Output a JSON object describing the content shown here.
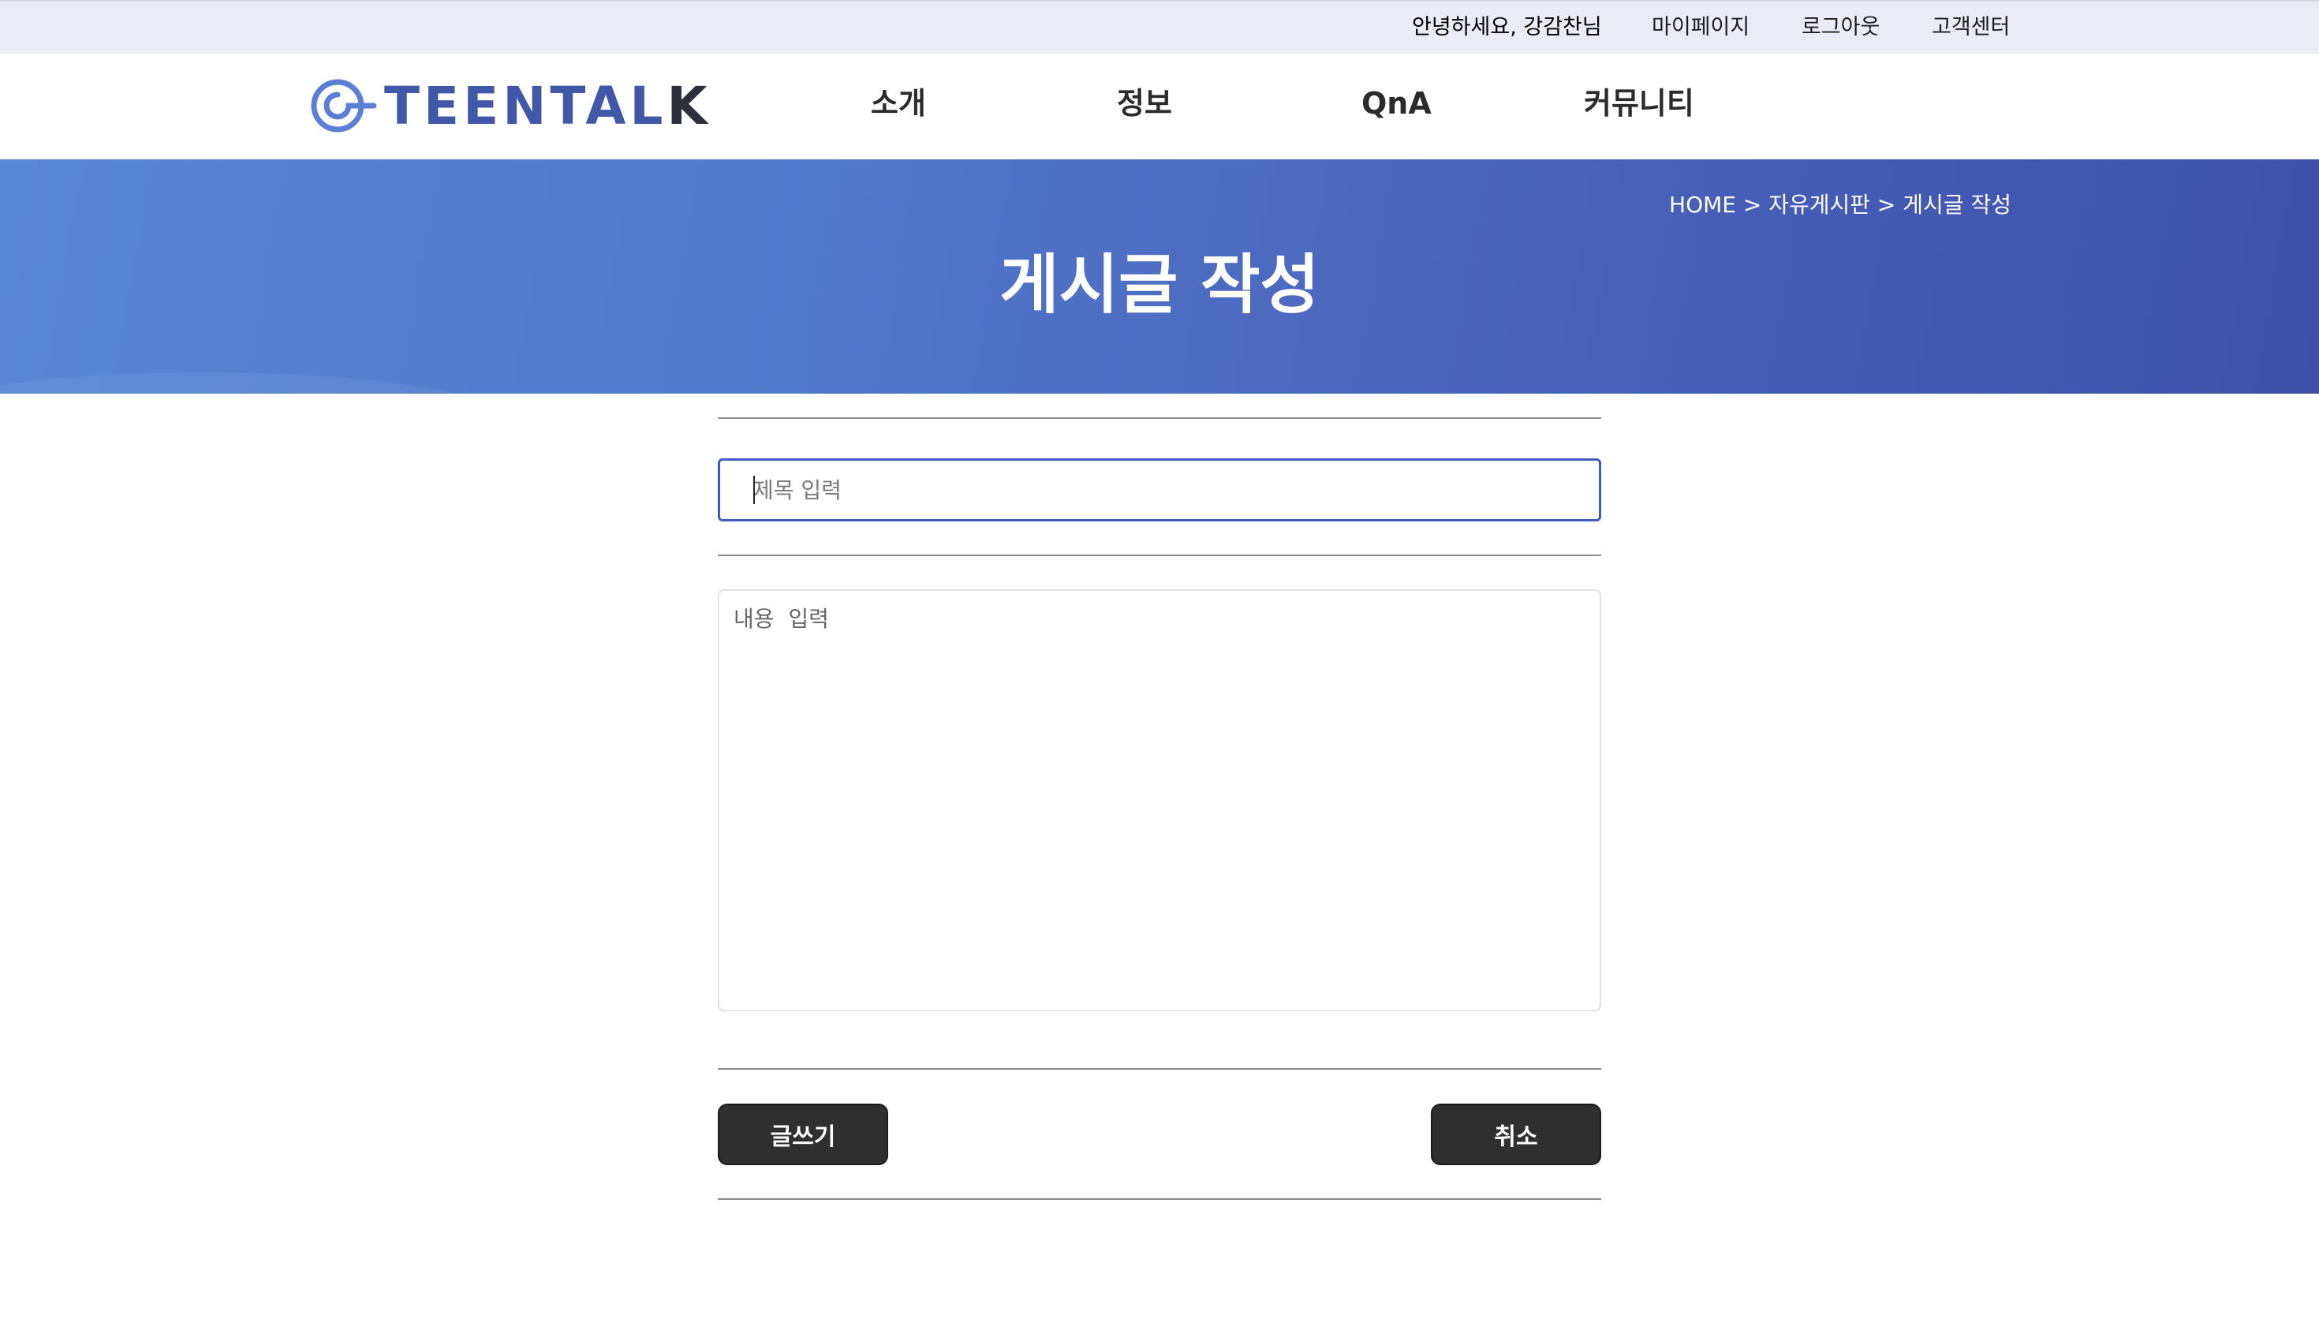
{
  "topbar": {
    "greeting": "안녕하세요, 강감찬님",
    "mypage": "마이페이지",
    "logout": "로그아웃",
    "customer_center": "고객센터"
  },
  "header": {
    "logo_main": "TEENTA",
    "logo_l": "L",
    "logo_k": "K",
    "nav": {
      "intro": "소개",
      "info": "정보",
      "qna": "QnA",
      "community": "커뮤니티"
    }
  },
  "banner": {
    "breadcrumb": "HOME > 자유게시판 > 게시글 작성",
    "title": "게시글 작성"
  },
  "form": {
    "title_placeholder": "제목 입력",
    "content_placeholder": "내용  입력",
    "submit_label": "글쓰기",
    "cancel_label": "취소"
  },
  "colors": {
    "brand": "#4158a8",
    "banner_start": "#5a86d6",
    "banner_end": "#3e4fa8",
    "button": "#2f2f2f",
    "focus_border": "#3f5bc1"
  }
}
